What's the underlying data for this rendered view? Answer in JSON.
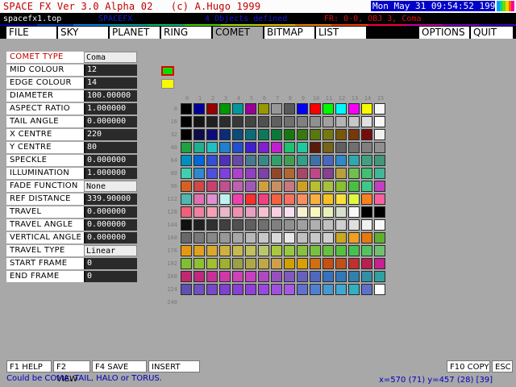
{
  "title": "SPACE FX Ver 3.0 Alpha 02   (c) A.Hugo 1999",
  "datetime": "Mon May 31 09:54:52 1999",
  "status": {
    "file_name": "spacefx1.top",
    "app_short": "SPACEFX",
    "objects_defined": "4 Objects defined",
    "frame_info": "FR: 0-0, OBJ 3, Coma"
  },
  "menu": {
    "file": "FILE",
    "sky": "SKY",
    "planet": "PLANET",
    "ring": "RING",
    "comet": "COMET",
    "bitmap": "BITMAP",
    "list": "LIST",
    "options": "OPTIONS",
    "quit": "QUIT",
    "active": "COMET"
  },
  "properties": [
    {
      "label": "COMET TYPE",
      "value": "Coma"
    },
    {
      "label": "MID COLOUR",
      "value": "12"
    },
    {
      "label": "EDGE COLOUR",
      "value": "14"
    },
    {
      "label": "DIAMETER",
      "value": "100.00000"
    },
    {
      "label": "ASPECT RATIO",
      "value": "1.000000"
    },
    {
      "label": "TAIL ANGLE",
      "value": "0.000000"
    },
    {
      "label": "X CENTRE",
      "value": "220"
    },
    {
      "label": "Y CENTRE",
      "value": "80"
    },
    {
      "label": "SPECKLE",
      "value": "0.000000"
    },
    {
      "label": "ILLUMINATION",
      "value": "1.000000"
    },
    {
      "label": "FADE FUNCTION",
      "value": "None"
    },
    {
      "label": "REF DISTANCE",
      "value": "339.90000"
    },
    {
      "label": "TRAVEL DISTANCE",
      "value": "0.000000"
    },
    {
      "label": "TRAVEL ANGLE",
      "value": "0.000000"
    },
    {
      "label": "VERTICAL ANGLE",
      "value": "0.000000"
    },
    {
      "label": "TRAVEL TYPE",
      "value": "Linear"
    },
    {
      "label": "START FRAME",
      "value": "0"
    },
    {
      "label": "END FRAME",
      "value": "0"
    }
  ],
  "swatches": {
    "mid_colour": "#00e000",
    "edge_colour": "#f8f800"
  },
  "palette": {
    "col_labels": [
      "0",
      "1",
      "2",
      "3",
      "4",
      "5",
      "6",
      "7",
      "8",
      "9",
      "10",
      "11",
      "12",
      "13",
      "14",
      "15"
    ],
    "row_labels": [
      "0",
      "16",
      "32",
      "48",
      "64",
      "80",
      "96",
      "112",
      "128",
      "144",
      "160",
      "176",
      "192",
      "208",
      "224",
      "240"
    ],
    "rows": [
      [
        "#000000",
        "#000098",
        "#980000",
        "#009800",
        "#009898",
        "#980098",
        "#989800",
        "#989898",
        "#585858",
        "#0000f8",
        "#f80000",
        "#00f800",
        "#00f8f8",
        "#f800f8",
        "#f8f800",
        "#f8f8f8"
      ],
      [
        "#000000",
        "#141414",
        "#202020",
        "#2c2c2c",
        "#383838",
        "#444444",
        "#505050",
        "#606060",
        "#707070",
        "#808080",
        "#909090",
        "#a0a0a0",
        "#b4b4b4",
        "#c8c8c8",
        "#e0e0e0",
        "#f8f8f8"
      ],
      [
        "#000000",
        "#0c0c48",
        "#0c0c78",
        "#0c2c78",
        "#0c4c78",
        "#0c6c78",
        "#0c7858",
        "#0c7838",
        "#187810",
        "#387810",
        "#587810",
        "#787810",
        "#78580c",
        "#78380c",
        "#780c0c",
        "#f0f0f0"
      ],
      [
        "#20a040",
        "#20b090",
        "#20c0c0",
        "#2080d0",
        "#2050d0",
        "#4020d0",
        "#8020d0",
        "#c020d0",
        "#20c070",
        "#20c8a0",
        "#5a1c08",
        "#786418",
        "#606060",
        "#707070",
        "#808080",
        "#909090"
      ],
      [
        "#0090c0",
        "#0068d8",
        "#3050d8",
        "#5030b8",
        "#6848a8",
        "#487890",
        "#388888",
        "#30a068",
        "#40a050",
        "#30a088",
        "#4070a8",
        "#4868c0",
        "#3088c8",
        "#30a8b0",
        "#40a080",
        "#409878"
      ],
      [
        "#40d0b0",
        "#3088d0",
        "#5050e0",
        "#8040e0",
        "#b040d0",
        "#9040c0",
        "#8040a8",
        "#904828",
        "#b06830",
        "#a84868",
        "#c04888",
        "#884090",
        "#b8a040",
        "#70c050",
        "#40c070",
        "#40b898"
      ],
      [
        "#d86020",
        "#d04848",
        "#c84070",
        "#c05090",
        "#c060b0",
        "#a058b8",
        "#d0a040",
        "#c89060",
        "#c87880",
        "#d0a020",
        "#b8c030",
        "#a8c040",
        "#88c030",
        "#48c040",
        "#40c888",
        "#c040c0"
      ],
      [
        "#50b8b0",
        "#e070b0",
        "#e090d0",
        "#c0f0f0",
        "#f040b0",
        "#f83030",
        "#f04080",
        "#f86040",
        "#f87060",
        "#f89060",
        "#f8b040",
        "#f8c020",
        "#f8e040",
        "#e0f840",
        "#f88020",
        "#f860a0"
      ],
      [
        "#f06078",
        "#f080a0",
        "#f8a0b8",
        "#e8b8c8",
        "#f090b0",
        "#e8a0c0",
        "#f8c0d0",
        "#f8d0e0",
        "#f8e0f0",
        "#f8f0d0",
        "#f8f8c0",
        "#e8f0b8",
        "#d8e0d0",
        "#f8f8f8",
        "#000000",
        "#000000"
      ],
      [
        "#101010",
        "#202020",
        "#303030",
        "#404040",
        "#505050",
        "#606060",
        "#707070",
        "#808080",
        "#909090",
        "#a0a0a0",
        "#b0b0b0",
        "#c0c0c0",
        "#d0d0d0",
        "#e0e0e0",
        "#f0f0f0",
        "#f8f8f8"
      ],
      [
        "#686868",
        "#787878",
        "#888888",
        "#989898",
        "#a8a8a8",
        "#b8b8b8",
        "#c8c8c8",
        "#d8d8d8",
        "#e8e8e8",
        "#c0c0c0",
        "#c8c8c8",
        "#d0d0d0",
        "#c8a820",
        "#f0a020",
        "#e87810",
        "#60b030"
      ],
      [
        "#e89810",
        "#e0a020",
        "#d8a830",
        "#d0b040",
        "#c8b850",
        "#c0c060",
        "#b8c870",
        "#a8c840",
        "#98c840",
        "#88c040",
        "#78c040",
        "#68c040",
        "#58c040",
        "#48c050",
        "#58c060",
        "#70c070"
      ],
      [
        "#80c030",
        "#90c030",
        "#a0c030",
        "#a0b030",
        "#9ca048",
        "#b0a848",
        "#c0a848",
        "#d0a048",
        "#d0a000",
        "#d8a000",
        "#d07010",
        "#c85010",
        "#c05018",
        "#c03030",
        "#b82050",
        "#c82090"
      ],
      [
        "#c02870",
        "#c02880",
        "#c83098",
        "#d038a8",
        "#d040b8",
        "#c840c0",
        "#b048c0",
        "#9850c0",
        "#8058c0",
        "#6860c0",
        "#5068c0",
        "#3870c0",
        "#3078b8",
        "#3080b0",
        "#3090a8",
        "#30a0a0"
      ],
      [
        "#6050b0",
        "#7050c0",
        "#7848c8",
        "#8040d0",
        "#8840d8",
        "#9040d8",
        "#9848e0",
        "#a050e0",
        "#a858e0",
        "#6070d0",
        "#5080d0",
        "#4898d0",
        "#40a8d0",
        "#30b0c0",
        "#6070c8",
        "#ffffff"
      ]
    ]
  },
  "function_keys": {
    "help": "F1 HELP",
    "view": "F2 VIEW",
    "save": "F4 SAVE",
    "insert": "INSERT",
    "copy": "F10 COPY",
    "esc": "ESC"
  },
  "help_text": "Could be COMA, TAIL, HALO or TORUS.",
  "coords": "x=570 (71) y=457 (28) [39]"
}
